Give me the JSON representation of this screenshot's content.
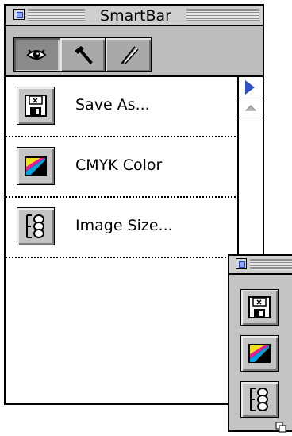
{
  "window": {
    "title": "SmartBar"
  },
  "toolbar": {
    "tools": [
      {
        "icon": "eye-icon",
        "active": true
      },
      {
        "icon": "hammer-icon",
        "active": false
      },
      {
        "icon": "brush-icon",
        "active": false
      }
    ]
  },
  "list": {
    "items": [
      {
        "label": "Save As...",
        "icon": "floppy-disk-icon"
      },
      {
        "label": "CMYK Color",
        "icon": "cmyk-color-icon"
      },
      {
        "label": "Image Size...",
        "icon": "image-size-icon"
      }
    ]
  },
  "mini_palette": {
    "items": [
      {
        "icon": "floppy-disk-icon"
      },
      {
        "icon": "cmyk-color-icon"
      },
      {
        "icon": "image-size-icon"
      }
    ]
  },
  "colors": {
    "accent": "#3050c8",
    "cmyk_cyan": "#00a0e0",
    "cmyk_magenta": "#e0208c",
    "cmyk_yellow": "#f0e020"
  }
}
